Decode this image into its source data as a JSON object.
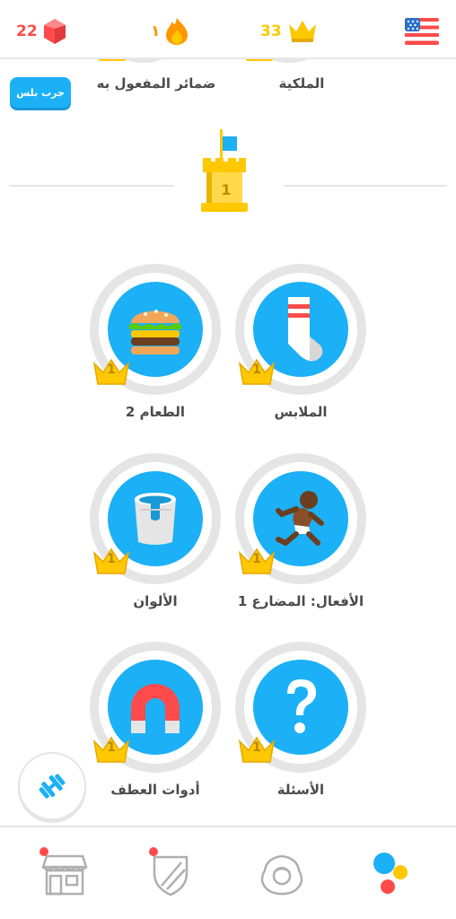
{
  "stats": {
    "gems": "22",
    "streak": "١",
    "crowns": "33"
  },
  "top_partial": {
    "left_label": "ضمائر المفعول به",
    "right_label": "الملكية"
  },
  "plus_button_label": "جرب بلس",
  "checkpoint": {
    "level": "1"
  },
  "skills": [
    {
      "label": "الطعام 2",
      "crown_level": "1",
      "icon": "burger-icon"
    },
    {
      "label": "الملابس",
      "crown_level": "1",
      "icon": "sock-icon"
    },
    {
      "label": "الألوان",
      "crown_level": "1",
      "icon": "paint-bucket-icon"
    },
    {
      "label": "الأفعال: المضارع 1",
      "crown_level": "1",
      "icon": "running-person-icon"
    },
    {
      "label": "أدوات العطف",
      "crown_level": "1",
      "icon": "magnet-icon"
    },
    {
      "label": "الأسئلة",
      "crown_level": "1",
      "icon": "question-mark-icon"
    }
  ],
  "nav": [
    {
      "name": "shop",
      "icon": "shop-icon",
      "notification": true
    },
    {
      "name": "leagues",
      "icon": "shield-icon",
      "notification": true
    },
    {
      "name": "profile",
      "icon": "profile-icon",
      "notification": false
    },
    {
      "name": "learn",
      "icon": "learn-dots-icon",
      "notification": false
    }
  ],
  "colors": {
    "accent_blue": "#1cb0f6",
    "gold": "#ffc800",
    "red": "#ff4b4b",
    "orange": "#ff9600",
    "ring_gray": "#e5e5e5"
  }
}
